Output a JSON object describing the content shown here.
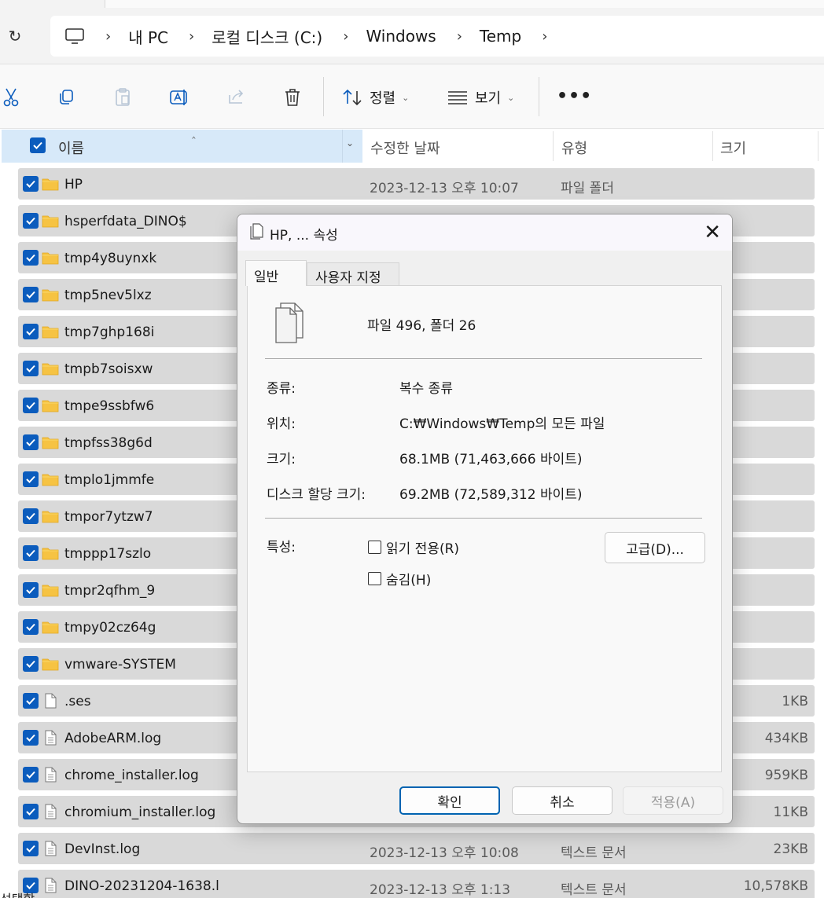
{
  "breadcrumb": {
    "items": [
      "내 PC",
      "로컬 디스크 (C:)",
      "Windows",
      "Temp"
    ]
  },
  "toolbar": {
    "sort_label": "정렬",
    "view_label": "보기",
    "more_label": "•••"
  },
  "columns": {
    "name": "이름",
    "modified": "수정한 날짜",
    "type": "유형",
    "size": "크기"
  },
  "files": [
    {
      "name": "HP",
      "date": "2023-12-13 오후 10:07",
      "type": "파일 폴더",
      "size": "",
      "kind": "folder"
    },
    {
      "name": "hsperfdata_DINO$",
      "date": "",
      "type": "",
      "size": "",
      "kind": "folder"
    },
    {
      "name": "tmp4y8uynxk",
      "date": "",
      "type": "",
      "size": "",
      "kind": "folder"
    },
    {
      "name": "tmp5nev5lxz",
      "date": "",
      "type": "",
      "size": "",
      "kind": "folder"
    },
    {
      "name": "tmp7ghp168i",
      "date": "",
      "type": "",
      "size": "",
      "kind": "folder"
    },
    {
      "name": "tmpb7soisxw",
      "date": "",
      "type": "",
      "size": "",
      "kind": "folder"
    },
    {
      "name": "tmpe9ssbfw6",
      "date": "",
      "type": "",
      "size": "",
      "kind": "folder"
    },
    {
      "name": "tmpfss38g6d",
      "date": "",
      "type": "",
      "size": "",
      "kind": "folder"
    },
    {
      "name": "tmplo1jmmfe",
      "date": "",
      "type": "",
      "size": "",
      "kind": "folder"
    },
    {
      "name": "tmpor7ytzw7",
      "date": "",
      "type": "",
      "size": "",
      "kind": "folder"
    },
    {
      "name": "tmppp17szlo",
      "date": "",
      "type": "",
      "size": "",
      "kind": "folder"
    },
    {
      "name": "tmpr2qfhm_9",
      "date": "",
      "type": "",
      "size": "",
      "kind": "folder"
    },
    {
      "name": "tmpy02cz64g",
      "date": "",
      "type": "",
      "size": "",
      "kind": "folder"
    },
    {
      "name": "vmware-SYSTEM",
      "date": "",
      "type": "",
      "size": "",
      "kind": "folder"
    },
    {
      "name": ".ses",
      "date": "",
      "type": "",
      "size": "1KB",
      "kind": "file"
    },
    {
      "name": "AdobeARM.log",
      "date": "",
      "type": "",
      "size": "434KB",
      "kind": "doc"
    },
    {
      "name": "chrome_installer.log",
      "date": "",
      "type": "",
      "size": "959KB",
      "kind": "doc"
    },
    {
      "name": "chromium_installer.log",
      "date": "",
      "type": "",
      "size": "11KB",
      "kind": "doc"
    },
    {
      "name": "DevInst.log",
      "date": "2023-12-13 오후 10:08",
      "type": "텍스트 문서",
      "size": "23KB",
      "kind": "doc"
    },
    {
      "name": "DINO-20231204-1638.l",
      "date": "2023-12-13 오후 1:13",
      "type": "텍스트 문서",
      "size": "10,578KB",
      "kind": "doc"
    }
  ],
  "status_bar": {
    "text": "선택함"
  },
  "dialog": {
    "title": "HP, ... 속성",
    "tabs": [
      "일반",
      "사용자 지정"
    ],
    "summary": "파일 496, 폴더 26",
    "props": [
      {
        "label": "종류:",
        "value": "복수 종류"
      },
      {
        "label": "위치:",
        "value": "C:₩Windows₩Temp의 모든 파일"
      },
      {
        "label": "크기:",
        "value": "68.1MB (71,463,666 바이트)"
      },
      {
        "label": "디스크 할당 크기:",
        "value": "69.2MB (72,589,312 바이트)"
      }
    ],
    "attributes_label": "특성:",
    "readonly_label": "읽기 전용(R)",
    "hidden_label": "숨김(H)",
    "advanced_label": "고급(D)...",
    "ok_label": "확인",
    "cancel_label": "취소",
    "apply_label": "적용(A)"
  },
  "colors": {
    "accent": "#0b5cbd",
    "selected_row": "#d9d9d9",
    "header_selected": "#d7e9f9",
    "folder": "#f6c343"
  }
}
